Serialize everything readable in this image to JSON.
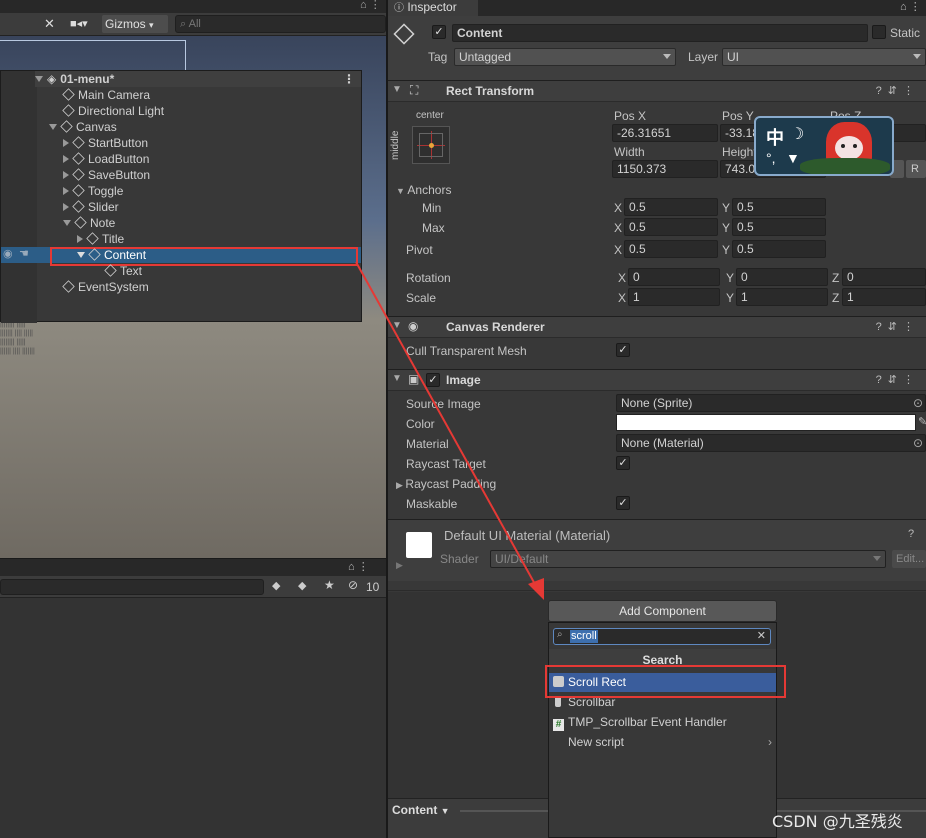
{
  "scene": {
    "toolbar": {
      "gizmos_label": "Gizmos",
      "search_placeholder": "All"
    },
    "hierarchy": {
      "scene_name": "01-menu*",
      "items": [
        {
          "label": "Main Camera"
        },
        {
          "label": "Directional Light"
        },
        {
          "label": "Canvas"
        },
        {
          "label": "StartButton"
        },
        {
          "label": "LoadButton"
        },
        {
          "label": "SaveButton"
        },
        {
          "label": "Toggle"
        },
        {
          "label": "Slider"
        },
        {
          "label": "Note"
        },
        {
          "label": "Title"
        },
        {
          "label": "Content"
        },
        {
          "label": "Text"
        },
        {
          "label": "EventSystem"
        }
      ]
    },
    "project_toolbar": {
      "hidden_count": "10"
    }
  },
  "inspector": {
    "tab_label": "Inspector",
    "object_name": "Content",
    "static_label": "Static",
    "tag_label": "Tag",
    "tag_value": "Untagged",
    "layer_label": "Layer",
    "layer_value": "UI",
    "rect_transform": {
      "title": "Rect Transform",
      "anchor_preset_top": "center",
      "anchor_preset_side": "middle",
      "pos_x_label": "Pos X",
      "pos_x": "-26.31651",
      "pos_y_label": "Pos Y",
      "pos_y": "-33.18",
      "pos_z_label": "Pos Z",
      "width_label": "Width",
      "width": "1150.373",
      "height_label": "Height",
      "height": "743.0",
      "r_label": "R",
      "anchors_label": "Anchors",
      "min_label": "Min",
      "max_label": "Max",
      "pivot_label": "Pivot",
      "rotation_label": "Rotation",
      "scale_label": "Scale",
      "x": "X",
      "y": "Y",
      "z": "Z",
      "min_x": "0.5",
      "min_y": "0.5",
      "max_x": "0.5",
      "max_y": "0.5",
      "pivot_x": "0.5",
      "pivot_y": "0.5",
      "rot_x": "0",
      "rot_y": "0",
      "rot_z": "0",
      "scale_x": "1",
      "scale_y": "1",
      "scale_z": "1"
    },
    "canvas_renderer": {
      "title": "Canvas Renderer",
      "cull_label": "Cull Transparent Mesh"
    },
    "image": {
      "title": "Image",
      "source_image_label": "Source Image",
      "source_image_value": "None (Sprite)",
      "color_label": "Color",
      "material_label": "Material",
      "material_value": "None (Material)",
      "raycast_target_label": "Raycast Target",
      "raycast_padding_label": "Raycast Padding",
      "maskable_label": "Maskable"
    },
    "material_block": {
      "title": "Default UI Material (Material)",
      "shader_label": "Shader",
      "shader_value": "UI/Default",
      "edit_label": "Edit..."
    },
    "add_component": {
      "button_label": "Add Component",
      "search_value": "scroll",
      "section_title": "Search",
      "results": [
        {
          "label": "Scroll Rect",
          "icon": "scroll-rect-icon"
        },
        {
          "label": "Scrollbar",
          "icon": "scrollbar-icon"
        },
        {
          "label": "TMP_Scrollbar Event Handler",
          "icon": "script-icon"
        },
        {
          "label": "New script",
          "icon": ""
        }
      ]
    },
    "bottom_tab": "Content"
  },
  "ime_widget": {
    "text": "中"
  },
  "watermark": "CSDN @九圣残炎",
  "colors": {
    "highlight_red": "#e53935",
    "selection_blue": "#2c5d87",
    "scroll_rect_blue": "#3a5d9c"
  }
}
